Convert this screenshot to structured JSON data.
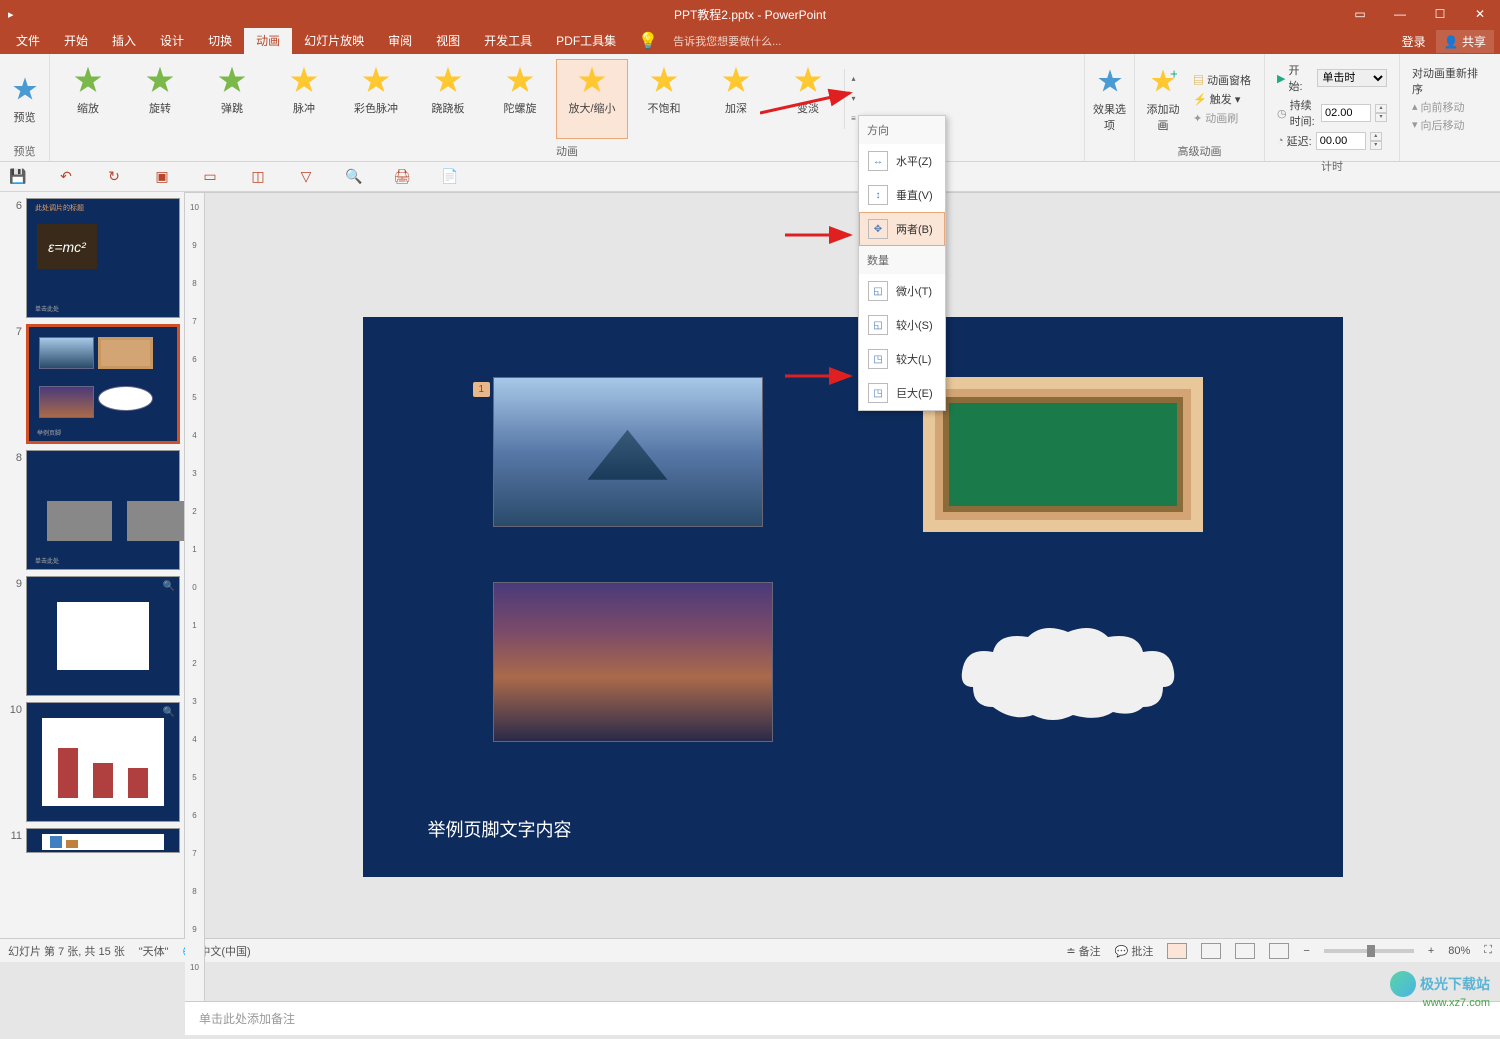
{
  "title": "PPT教程2.pptx - PowerPoint",
  "tabs": [
    "文件",
    "开始",
    "插入",
    "设计",
    "切换",
    "动画",
    "幻灯片放映",
    "审阅",
    "视图",
    "开发工具",
    "PDF工具集"
  ],
  "tellme": "告诉我您想要做什么...",
  "login": "登录",
  "share": "共享",
  "ribbon": {
    "preview": {
      "label": "预览",
      "group": "预览"
    },
    "animations": [
      {
        "name": "缩放"
      },
      {
        "name": "旋转"
      },
      {
        "name": "弹跳"
      },
      {
        "name": "脉冲"
      },
      {
        "name": "彩色脉冲"
      },
      {
        "name": "跷跷板"
      },
      {
        "name": "陀螺旋"
      },
      {
        "name": "放大/缩小",
        "selected": true
      },
      {
        "name": "不饱和"
      },
      {
        "name": "加深"
      },
      {
        "name": "变淡"
      }
    ],
    "anim_group": "动画",
    "effect_options": "效果选项",
    "add_anim": "添加动画",
    "anim_pane": "动画窗格",
    "trigger": "触发",
    "anim_painter": "动画刷",
    "advanced_group": "高级动画",
    "start_label": "开始:",
    "start_value": "单击时",
    "duration_label": "持续时间:",
    "duration_value": "02.00",
    "delay_label": "延迟:",
    "delay_value": "00.00",
    "timing_group": "计时",
    "reorder_title": "对动画重新排序",
    "move_earlier": "向前移动",
    "move_later": "向后移动"
  },
  "dropdown": {
    "section1": "方向",
    "items1": [
      {
        "label": "水平(Z)"
      },
      {
        "label": "垂直(V)"
      },
      {
        "label": "两者(B)",
        "selected": true
      }
    ],
    "section2": "数量",
    "items2": [
      {
        "label": "微小(T)"
      },
      {
        "label": "较小(S)"
      },
      {
        "label": "较大(L)"
      },
      {
        "label": "巨大(E)"
      }
    ]
  },
  "slide": {
    "tag": "1",
    "footer": "举例页脚文字内容"
  },
  "thumbs": [
    {
      "num": "6"
    },
    {
      "num": "7",
      "active": true
    },
    {
      "num": "8"
    },
    {
      "num": "9"
    },
    {
      "num": "10"
    },
    {
      "num": "11"
    }
  ],
  "notes_placeholder": "单击此处添加备注",
  "status": {
    "slideinfo": "幻灯片 第 7 张, 共 15 张",
    "theme": "\"天体\"",
    "lang": "中文(中国)",
    "notes": "备注",
    "comments": "批注",
    "zoom": "80%"
  },
  "watermark": "极光下载站",
  "watermark2": "www.xz7.com"
}
